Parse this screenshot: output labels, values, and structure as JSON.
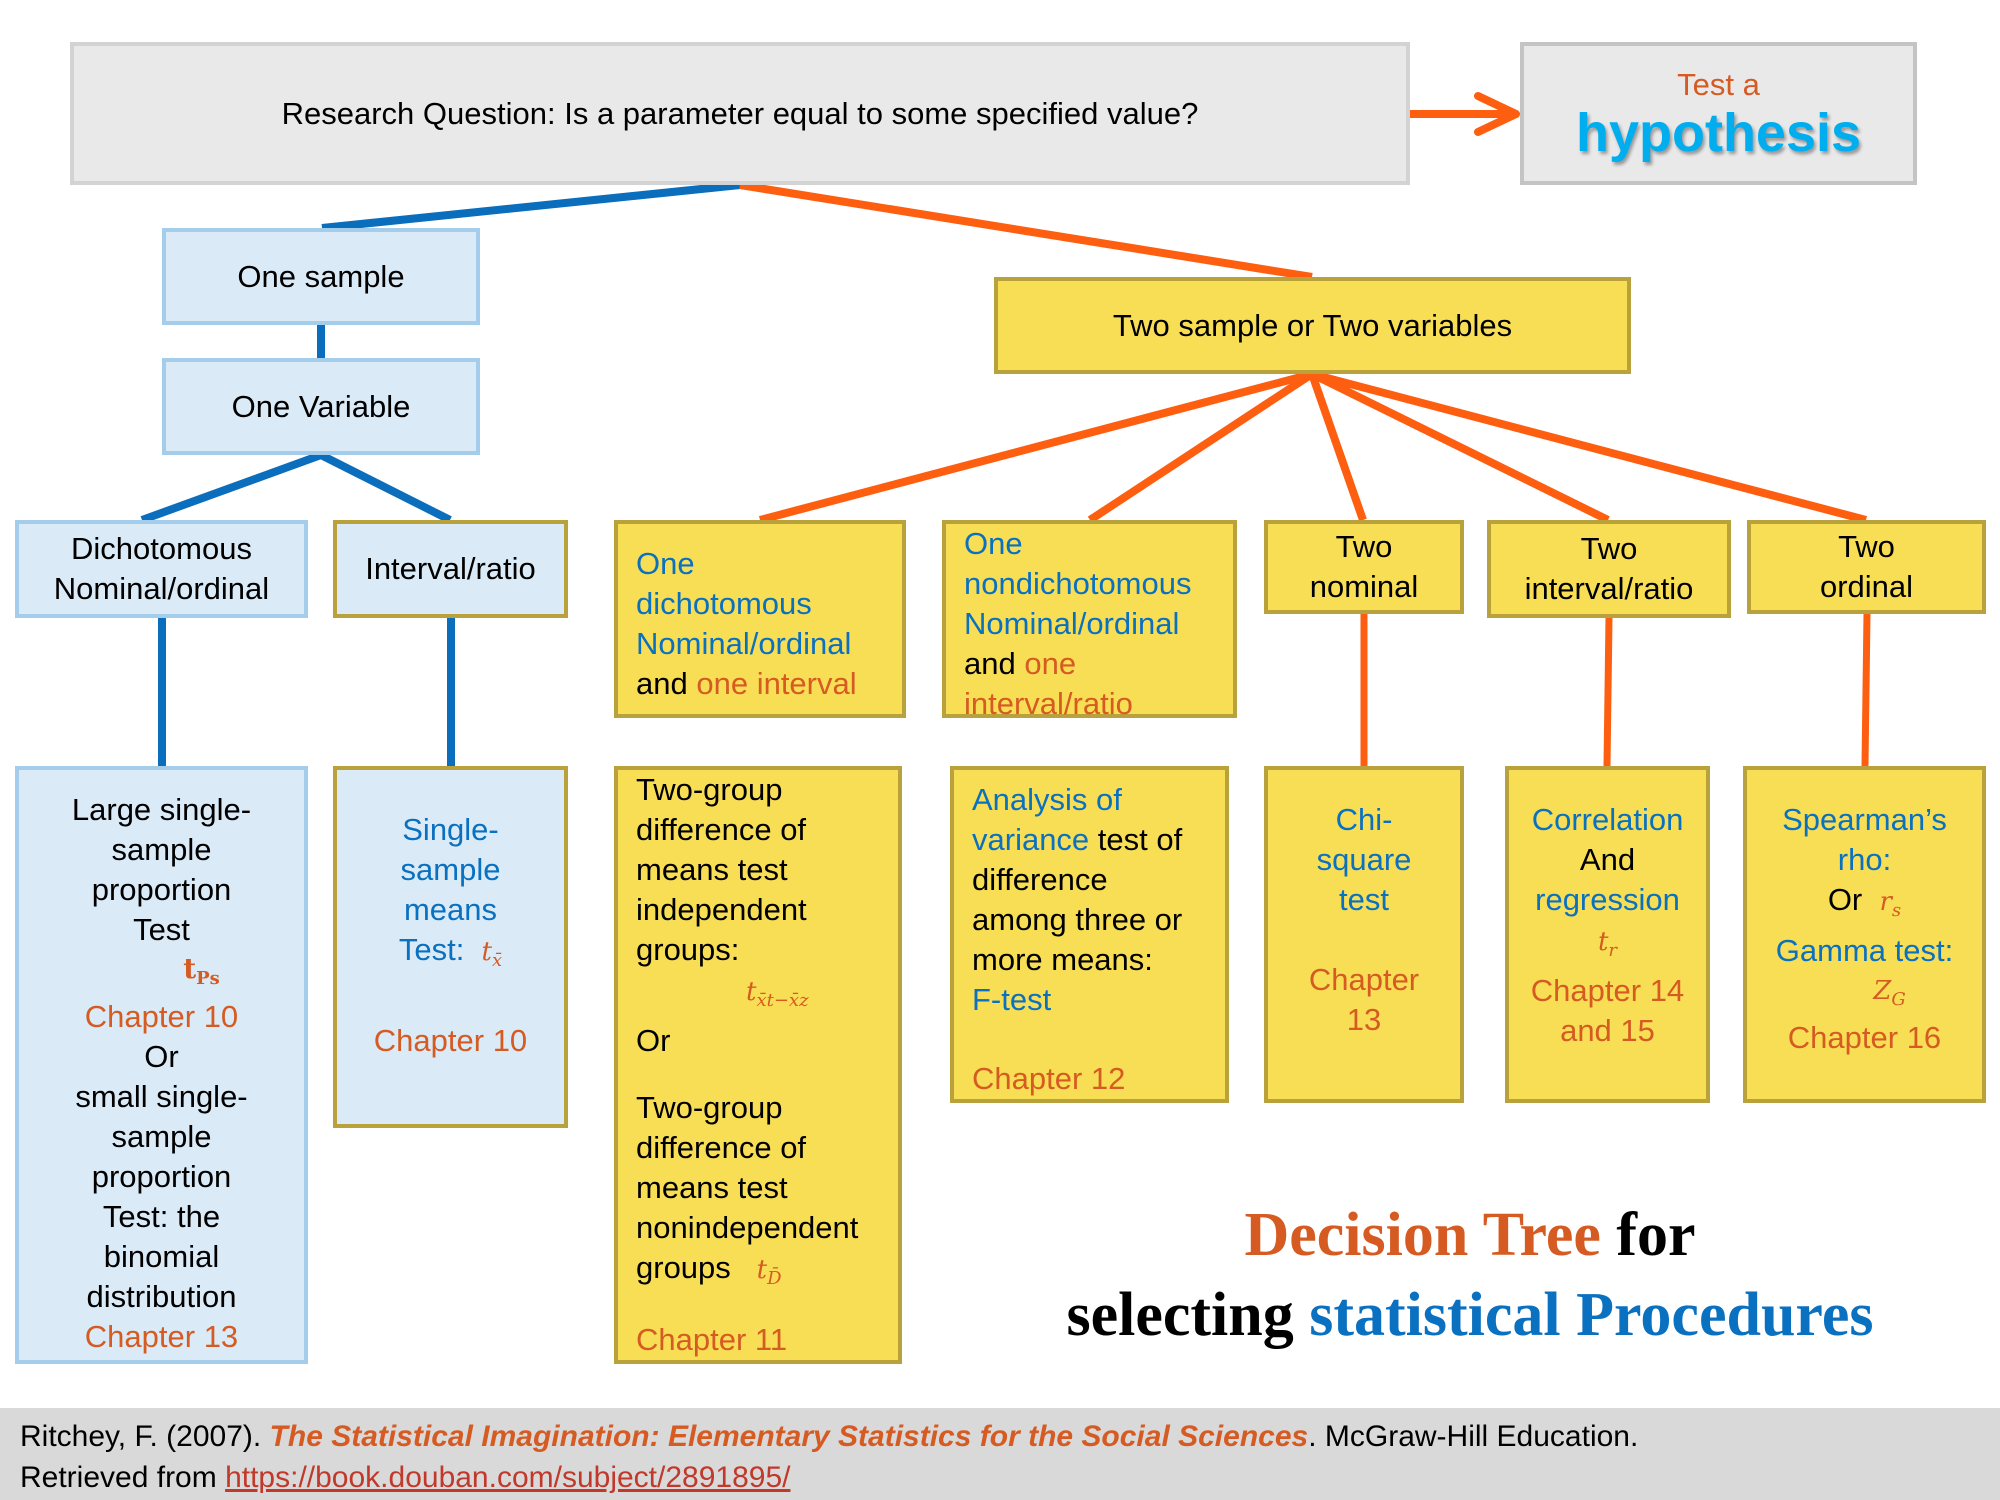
{
  "root": {
    "question": "Research Question: Is a parameter equal to some specified value?",
    "result_line1": "Test a",
    "result_line2": "hypothesis"
  },
  "left_branch": {
    "level1": "One sample",
    "level2": "One Variable",
    "categories": [
      {
        "line1": "Dichotomous",
        "line2": "Nominal/ordinal"
      },
      {
        "line1": "Interval/ratio"
      }
    ],
    "tests": [
      {
        "lines": [
          "Large single-",
          "sample",
          "proportion",
          "Test"
        ],
        "symbol": "t",
        "symbol_sub": "Ps",
        "chapter_a": "Chapter 10",
        "or": "Or",
        "lines_b": [
          "small single-",
          "sample",
          "proportion",
          "Test: the",
          "binomial",
          "distribution"
        ],
        "chapter_b": "Chapter 13"
      },
      {
        "lines": [
          "Single-",
          "sample",
          "means"
        ],
        "last": "Test:",
        "symbol": "t",
        "symbol_sub": "x̄",
        "chapter": "Chapter 10"
      }
    ]
  },
  "right_branch": {
    "level1": "Two sample or Two variables",
    "categories": [
      {
        "blue": [
          "One",
          "dichotomous",
          "Nominal/ordinal"
        ],
        "and": "and",
        "orange": "one interval"
      },
      {
        "blue": [
          "One",
          "nondichotomous",
          "Nominal/ordinal"
        ],
        "and": "and",
        "orange1": "one",
        "orange2": "interval/ratio"
      },
      {
        "line1": "Two",
        "line2": "nominal"
      },
      {
        "line1": "Two",
        "line2": "interval/ratio"
      },
      {
        "line1": "Two",
        "line2": "ordinal"
      }
    ],
    "tests": [
      {
        "lines_a": [
          "Two-group",
          "difference of",
          "means test",
          "independent",
          "groups:"
        ],
        "symbol_a": "t",
        "symbol_a_sub": "x̄t−x̄z",
        "or": "Or",
        "lines_b": [
          "Two-group",
          "difference of",
          "means test",
          "nonindependent"
        ],
        "last_b": "groups",
        "symbol_b": "t",
        "symbol_b_sub": "D̄",
        "chapter": "Chapter 11"
      },
      {
        "blue1": "Analysis of",
        "blue2": "variance",
        "black2": " test of",
        "lines": [
          "difference",
          "among three or",
          "more means:"
        ],
        "blue3": "F-test",
        "chapter": "Chapter 12"
      },
      {
        "blue": [
          "Chi-",
          "square",
          "test"
        ],
        "chapter_lines": [
          "Chapter",
          "13"
        ]
      },
      {
        "blue1": "Correlation",
        "black": "And",
        "blue2": "regression",
        "symbol": "t",
        "symbol_sub": "r",
        "chapter_lines": [
          "Chapter 14",
          "and 15"
        ]
      },
      {
        "blue1": "Spearman’s",
        "blue2": "rho:",
        "black": "Or",
        "symbol1": "r",
        "symbol1_sub": "s",
        "blue3": "Gamma test:",
        "symbol2": "Z",
        "symbol2_sub": "G",
        "chapter": "Chapter 16"
      }
    ]
  },
  "title": {
    "orange": "Decision Tree",
    "black1": " for",
    "black2": "selecting ",
    "blue": "statistical Procedures"
  },
  "footer": {
    "author": "Ritchey, F. (2007). ",
    "book": "The Statistical Imagination:  Elementary Statistics for the Social Sciences",
    "publisher": ". McGraw-Hill Education.",
    "retrieved": "Retrieved from ",
    "url": "https://book.douban.com/subject/2891895/"
  },
  "colors": {
    "blue_line": "#0a6ebd",
    "orange_line": "#fe5e10",
    "yellow_fill": "#f8de55",
    "blue_fill": "#daeaf6",
    "text_blue": "#0a70c0",
    "text_orange": "#d55b22",
    "hypothesis_blue": "#00aeef"
  }
}
